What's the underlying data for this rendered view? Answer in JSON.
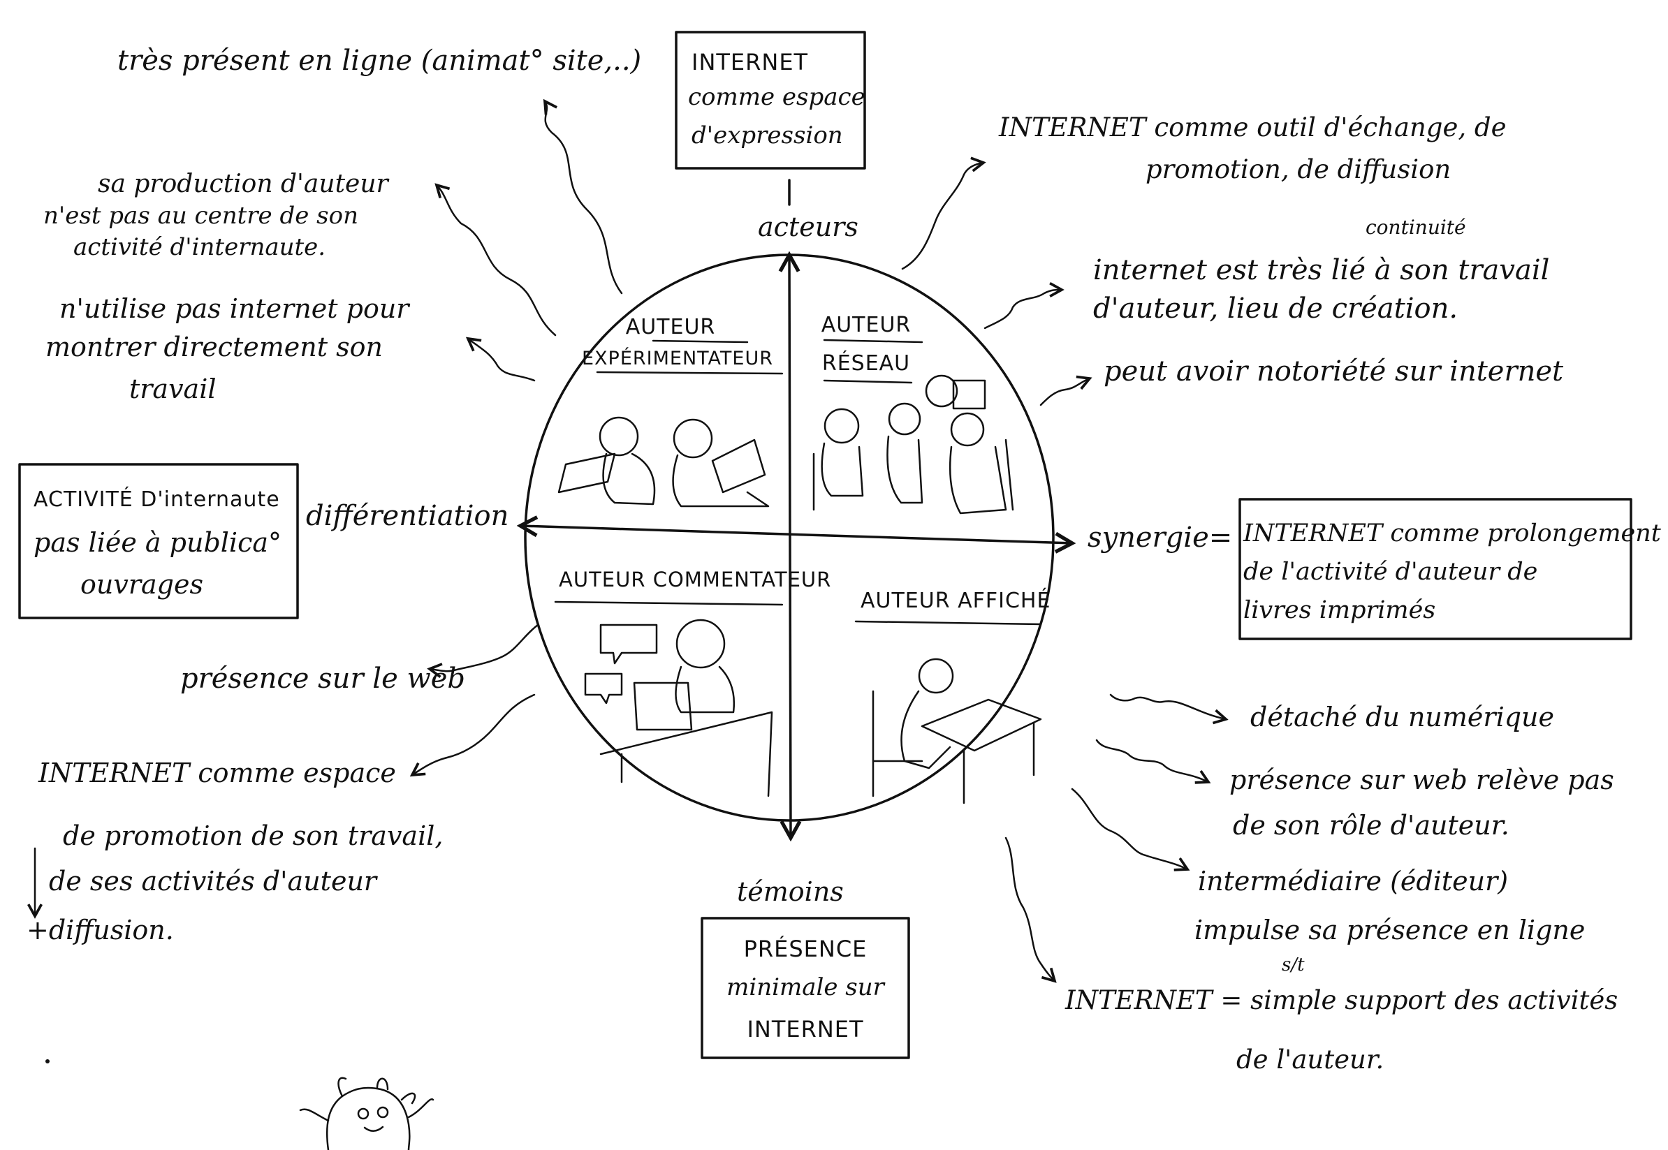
{
  "colors": {
    "ink": "#111111",
    "paper": "#ffffff"
  },
  "axes": {
    "top": "acteurs",
    "bottom": "témoins",
    "left": "différentiation",
    "right": "synergie="
  },
  "quadrants": {
    "top_left": "AUTEUR EXPÉRIMENTATEUR",
    "top_right": "AUTEUR RÉSEAU",
    "bottom_left": "AUTEUR COMMENTATEUR",
    "bottom_right": "AUTEUR AFFICHÉ"
  },
  "boxes": {
    "top": [
      "INTERNET",
      "comme espace",
      "d'expression"
    ],
    "left": [
      "ACTIVITÉ D'internaute",
      "pas liée à publica°",
      "ouvrages"
    ],
    "right": [
      "INTERNET comme prolongement",
      "de l'activité d'auteur de",
      "livres imprimés"
    ],
    "bottom": [
      "PRÉSENCE",
      "minimale sur",
      "INTERNET"
    ]
  },
  "notes": {
    "top_left_online": "très présent en ligne (animat° site,..)",
    "top_left_production": [
      "sa production d'auteur",
      "n'est pas au centre de son",
      "activité d'internaute."
    ],
    "top_left_not_showing": [
      "n'utilise pas internet pour",
      "montrer directement son",
      "travail"
    ],
    "top_right_exchange": [
      "INTERNET comme outil d'échange, de",
      "promotion, de diffusion"
    ],
    "top_right_continuity_label": "continuité",
    "top_right_linked": [
      "internet est très lié à son travail",
      "d'auteur, lieu de création."
    ],
    "top_right_notoriety": "peut avoir notoriété sur internet",
    "bottom_left_web": "présence sur le web",
    "bottom_left_promotion": [
      "INTERNET comme espace",
      "de promotion de son travail,",
      "de ses activités d'auteur",
      "+diffusion."
    ],
    "bottom_right_detached": "détaché du numérique",
    "bottom_right_role": [
      "présence sur web relève pas",
      "de son rôle d'auteur."
    ],
    "bottom_right_intermediary": [
      "intermédiaire (éditeur)",
      "impulse sa présence en ligne"
    ],
    "bottom_right_intermediary_sub": "s/t",
    "bottom_right_support": [
      "INTERNET = simple support des activités",
      "de l'auteur."
    ]
  },
  "icons": [
    "monster-doodle",
    "squiggle-arrow",
    "person-sketch",
    "laptop-sketch",
    "speech-bubble"
  ]
}
